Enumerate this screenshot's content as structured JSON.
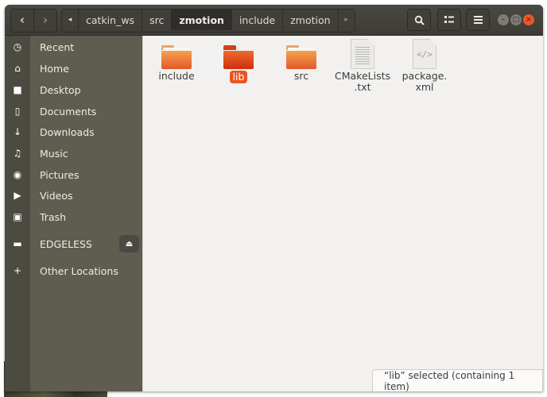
{
  "toolbar": {
    "back_icon": "chevron-left",
    "forward_icon": "chevron-right",
    "path_left_arrow": "◂",
    "path_right_arrow": "▸",
    "breadcrumb": [
      {
        "label": "catkin_ws",
        "current": false
      },
      {
        "label": "src",
        "current": false
      },
      {
        "label": "zmotion",
        "current": true
      },
      {
        "label": "include",
        "current": false
      },
      {
        "label": "zmotion",
        "current": false
      }
    ],
    "search_icon": "search-icon",
    "view_icon": "view-toggle-icon",
    "menu_icon": "hamburger-menu-icon"
  },
  "window_controls": {
    "minimize": "–",
    "maximize": "□",
    "close": "×"
  },
  "sidebar": {
    "items": [
      {
        "label": "Recent",
        "icon": "clock"
      },
      {
        "label": "Home",
        "icon": "home"
      },
      {
        "label": "Desktop",
        "icon": "folder"
      },
      {
        "label": "Documents",
        "icon": "document"
      },
      {
        "label": "Downloads",
        "icon": "download"
      },
      {
        "label": "Music",
        "icon": "music"
      },
      {
        "label": "Pictures",
        "icon": "camera"
      },
      {
        "label": "Videos",
        "icon": "video"
      },
      {
        "label": "Trash",
        "icon": "trash"
      }
    ],
    "devices": [
      {
        "label": "EDGELESS",
        "icon": "drive",
        "eject": "⏏"
      }
    ],
    "other": {
      "label": "Other Locations",
      "icon": "+"
    }
  },
  "files": [
    {
      "name": "include",
      "type": "folder",
      "selected": false
    },
    {
      "name": "lib",
      "type": "folder",
      "selected": true
    },
    {
      "name": "src",
      "type": "folder",
      "selected": false
    },
    {
      "name": "CMakeLists\n.txt",
      "line1": "CMakeLists",
      "line2": ".txt",
      "type": "text",
      "selected": false
    },
    {
      "name": "package.\nxml",
      "line1": "package.",
      "line2": "xml",
      "type": "xml",
      "code_glyph": "</>",
      "selected": false
    }
  ],
  "status": {
    "text": "“lib” selected  (containing 1 item)"
  },
  "colors": {
    "accent": "#e95420",
    "sidebar": "#5f5d50",
    "headerbar": "#3d3c37"
  }
}
